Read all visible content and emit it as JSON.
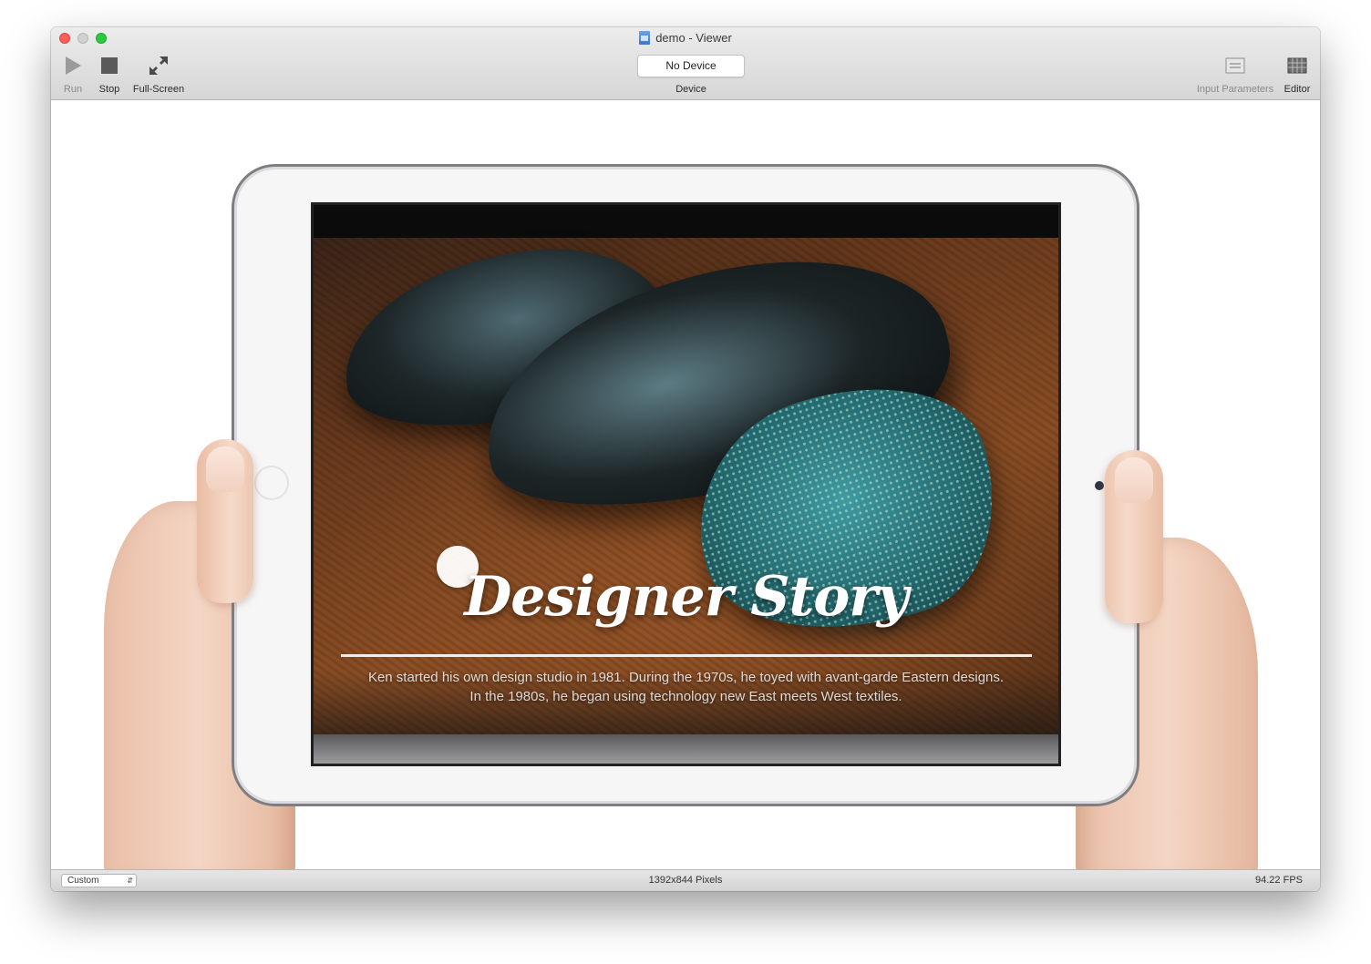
{
  "window": {
    "title": "demo - Viewer"
  },
  "toolbar": {
    "run_label": "Run",
    "stop_label": "Stop",
    "fullscreen_label": "Full-Screen",
    "device_button": "No Device",
    "device_label": "Device",
    "input_params_label": "Input Parameters",
    "editor_label": "Editor"
  },
  "preview": {
    "title": "Designer Story",
    "text_line1": "Ken started his own design studio in 1981. During the 1970s, he toyed with avant-garde Eastern designs.",
    "text_line2": "In the 1980s, he began using technology new East meets West textiles."
  },
  "statusbar": {
    "size_select": "Custom",
    "resolution": "1392x844 Pixels",
    "fps": "94.22 FPS"
  },
  "colors": {
    "close": "#fc5f57",
    "minimize": "#d0d0d0",
    "zoom": "#2ac940"
  }
}
